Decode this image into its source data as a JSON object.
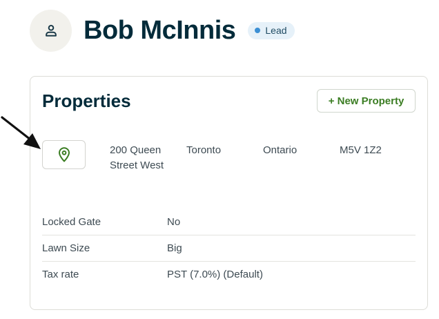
{
  "client": {
    "name": "Bob McInnis",
    "badge": "Lead",
    "avatar_icon": "user-icon"
  },
  "properties": {
    "title": "Properties",
    "new_button": "+ New Property",
    "address": {
      "street": "200 Queen Street West",
      "city": "Toronto",
      "province": "Ontario",
      "postal": "M5V 1Z2",
      "icon": "map-pin-icon"
    },
    "fields": [
      {
        "label": "Locked Gate",
        "value": "No"
      },
      {
        "label": "Lawn Size",
        "value": "Big"
      },
      {
        "label": "Tax rate",
        "value": "PST (7.0%) (Default)"
      }
    ]
  },
  "colors": {
    "heading": "#032b3a",
    "accent_green": "#3b7d23",
    "badge_bg": "#e6f1f9",
    "badge_dot": "#3b8fd4",
    "avatar_bg": "#f2f1ec"
  }
}
